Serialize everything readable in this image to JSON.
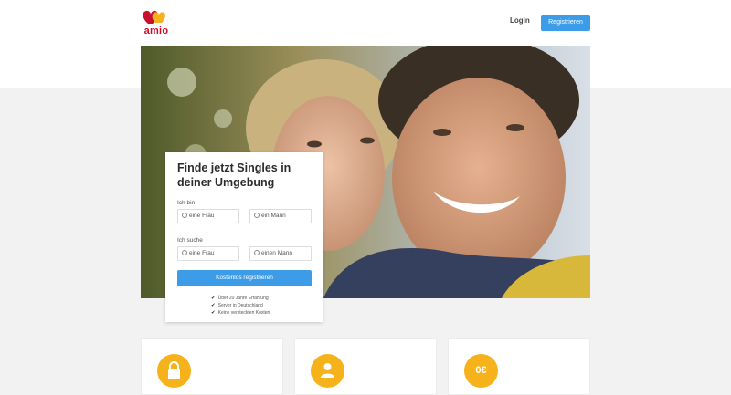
{
  "header": {
    "logo_text": "amio",
    "login_label": "Login",
    "register_label": "Registrieren",
    "accent": "#3d9ce8"
  },
  "form": {
    "title": "Finde jetzt Singles in deiner Umgebung",
    "i_am_label": "Ich bin",
    "i_am_options": [
      "eine Frau",
      "ein Mann"
    ],
    "looking_label": "Ich suche",
    "looking_options": [
      "eine Frau",
      "einen Mann"
    ],
    "cta_label": "Kostenlos registrieren",
    "bullets": [
      "Über 20 Jahre Erfahrung",
      "Server in Deutschland",
      "Keine versteckten Kosten"
    ]
  },
  "features": [
    {
      "icon": "lock-icon"
    },
    {
      "icon": "person-icon"
    },
    {
      "icon_text": "0€",
      "icon": "euro-icon"
    }
  ],
  "colors": {
    "feature_icon_bg": "#f5b21b",
    "logo": "#c8102e"
  }
}
